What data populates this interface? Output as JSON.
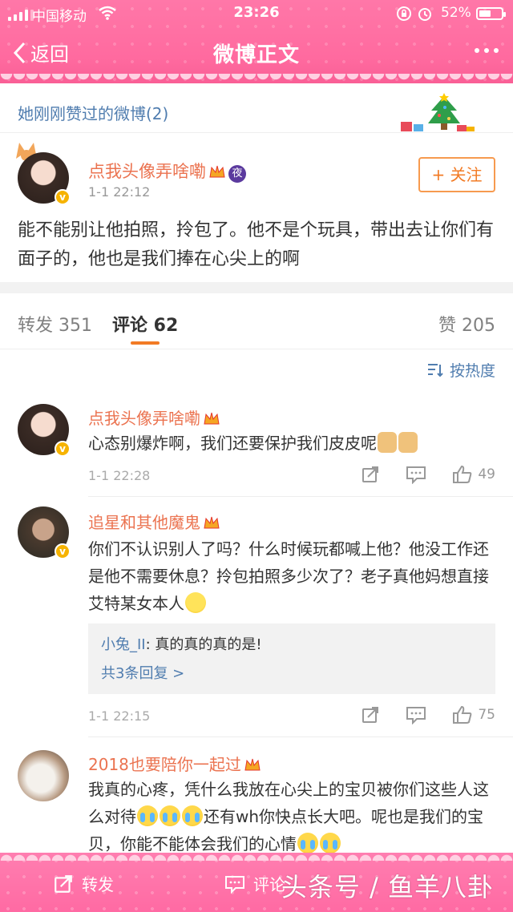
{
  "status_bar": {
    "carrier": "中国移动",
    "time": "23:26",
    "battery": "52%",
    "battery_level": 0.52
  },
  "nav": {
    "back_label": "返回",
    "title": "微博正文"
  },
  "liked_header": "她刚刚赞过的微博(2)",
  "post": {
    "username": "点我头像弄啥嘞",
    "night_badge": "夜",
    "time": "1-1 22:12",
    "follow_label": "+ 关注",
    "text": "能不能别让他拍照，拎包了。他不是个玩具，带出去让你们有面子的，他也是我们捧在心尖上的啊"
  },
  "tabs": {
    "repost": "转发 351",
    "comments": "评论 62",
    "likes": "赞 205"
  },
  "sort_label": "按热度",
  "comments": [
    {
      "username": "点我头像弄啥嘞",
      "text": "心态别爆炸啊，我们还要保护我们皮皮呢",
      "time": "1-1 22:28",
      "likes": "49"
    },
    {
      "username": "追星和其他魔鬼",
      "text": "你们不认识别人了吗？什么时候玩都喊上他？他没工作还是他不需要休息？拎包拍照多少次了？老子真他妈想直接艾特某女本人",
      "reply_user": "小兔_II",
      "reply_text": ": 真的真的真的是!",
      "reply_more": "共3条回复 >",
      "time": "1-1 22:15",
      "likes": "75"
    },
    {
      "username": "2018也要陪你一起过",
      "text_a": "我真的心疼，凭什么我放在心尖上的宝贝被你们这些人这么对待",
      "text_b": "还有wh你快点长大吧。呢也是我们的宝贝，你能不能体会我们的心情"
    }
  ],
  "bottom_bar": {
    "repost": "转发",
    "comment": "评论",
    "watermark": "头条号 / 鱼羊八卦"
  }
}
